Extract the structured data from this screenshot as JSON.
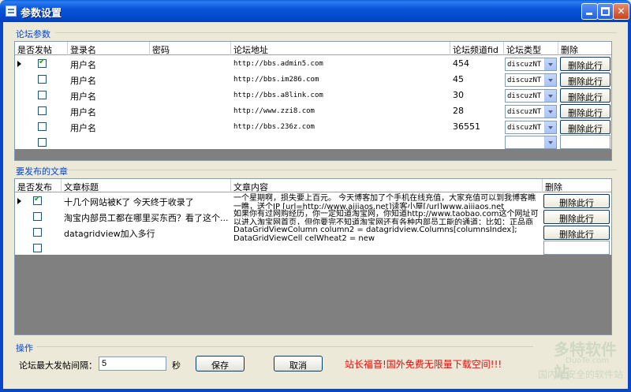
{
  "window": {
    "title": "参数设置"
  },
  "forum_group": {
    "label": "论坛参数",
    "columns": [
      "是否发帖",
      "登录名",
      "密码",
      "论坛地址",
      "论坛频道fid",
      "论坛类型",
      "删除"
    ],
    "rows": [
      {
        "checked": true,
        "login": "用户名",
        "password": "",
        "url": "http://bbs.admin5.com",
        "fid": "454",
        "type": "discuzNT",
        "delete": "删除此行"
      },
      {
        "checked": false,
        "login": "用户名",
        "password": "",
        "url": "http://bbs.im286.com",
        "fid": "45",
        "type": "discuzNT",
        "delete": "删除此行"
      },
      {
        "checked": false,
        "login": "用户名",
        "password": "",
        "url": "http://bbs.a8link.com",
        "fid": "30",
        "type": "discuzNT",
        "delete": "删除此行"
      },
      {
        "checked": false,
        "login": "用户名",
        "password": "",
        "url": "http://www.zzi8.com",
        "fid": "28",
        "type": "discuzNT",
        "delete": "删除此行"
      },
      {
        "checked": false,
        "login": "用户名",
        "password": "",
        "url": "http://bbs.236z.com",
        "fid": "36551",
        "type": "discuzNT",
        "delete": "删除此行"
      }
    ]
  },
  "article_group": {
    "label": "要发布的文章",
    "columns": [
      "是否发布",
      "文章标题",
      "文章内容",
      "删除"
    ],
    "rows": [
      {
        "checked": true,
        "title": "十几个网站被K了 今天终于收录了",
        "content": "一个星期啊，损失要上百元。 今天博客加了个手机在线充值，大家充值可以到我博客瞧一瞧，送个IP [url=http://www.aijiaos.net]读客小屋[/url]www.aijiaos.net",
        "delete": "删除此行"
      },
      {
        "checked": false,
        "title": "淘宝内部员工都在哪里买东西？看了这个...",
        "content": "如果你有过网购经历，你一定知道淘宝网，你知道http://www.taobao.com这个网址可以进入淘宝网首页，但你要完不知道淘宝网还有各种内部员工能的通道：比如：正品商",
        "delete": "删除此行"
      },
      {
        "checked": false,
        "title": "datagridview加入多行",
        "content": "DataGridViewColumn column2 = datagridview.Columns[columnsIndex]; DataGridViewCell celWheat2 = new",
        "delete": "删除此行"
      }
    ]
  },
  "ops_group": {
    "label": "操作",
    "interval_label": "论坛最大发帖间隔：",
    "interval_value": "5",
    "unit": "秒",
    "save_label": "保存",
    "cancel_label": "取消",
    "promo_text": "站长福音!国外免费无限量下载空间!!!"
  },
  "watermark": {
    "brand": "多特软件站",
    "domain": "DuoTe.com",
    "slogan": "国内最安全的软件站"
  },
  "colors": {
    "titlebar": "#0955d8",
    "group_label": "#0046d5",
    "promo": "#ff0000",
    "grid_bg": "#808080"
  }
}
